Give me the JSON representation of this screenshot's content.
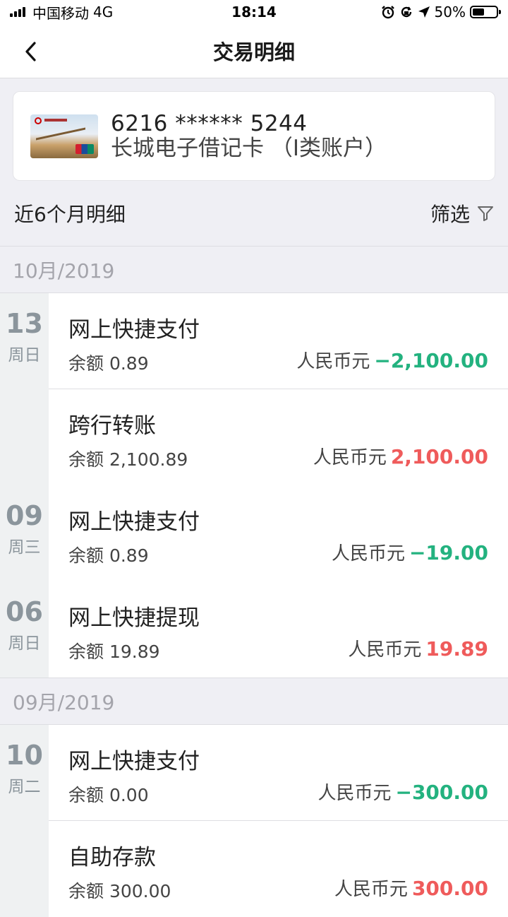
{
  "status_bar": {
    "carrier": "中国移动",
    "network": "4G",
    "time": "18:14",
    "battery": "50%"
  },
  "nav": {
    "title": "交易明细"
  },
  "card": {
    "number": "6216 ****** 5244",
    "name": "长城电子借记卡 （I类账户）"
  },
  "list_header": {
    "title": "近6个月明细",
    "filter_label": "筛选"
  },
  "months": [
    {
      "label": "10月/2019",
      "days": [
        {
          "day": "13",
          "weekday": "周日",
          "transactions": [
            {
              "title": "网上快捷支付",
              "balance": "余额 0.89",
              "currency": "人民币元",
              "amount": "−2,100.00",
              "kind": "neg"
            },
            {
              "title": "跨行转账",
              "balance": "余额 2,100.89",
              "currency": "人民币元",
              "amount": "2,100.00",
              "kind": "pos"
            }
          ]
        },
        {
          "day": "09",
          "weekday": "周三",
          "transactions": [
            {
              "title": "网上快捷支付",
              "balance": "余额 0.89",
              "currency": "人民币元",
              "amount": "−19.00",
              "kind": "neg"
            }
          ]
        },
        {
          "day": "06",
          "weekday": "周日",
          "transactions": [
            {
              "title": "网上快捷提现",
              "balance": "余额 19.89",
              "currency": "人民币元",
              "amount": "19.89",
              "kind": "pos"
            }
          ]
        }
      ]
    },
    {
      "label": "09月/2019",
      "days": [
        {
          "day": "10",
          "weekday": "周二",
          "transactions": [
            {
              "title": "网上快捷支付",
              "balance": "余额 0.00",
              "currency": "人民币元",
              "amount": "−300.00",
              "kind": "neg"
            },
            {
              "title": "自助存款",
              "balance": "余额 300.00",
              "currency": "人民币元",
              "amount": "300.00",
              "kind": "pos"
            }
          ]
        }
      ]
    }
  ],
  "colors": {
    "negative": "#23b27f",
    "positive": "#ef5b5b",
    "background": "#efeff4"
  },
  "icons": {
    "back": "chevron-left-icon",
    "filter": "funnel-icon",
    "alarm": "alarm-icon",
    "lock": "rotation-lock-icon",
    "location": "location-arrow-icon"
  }
}
